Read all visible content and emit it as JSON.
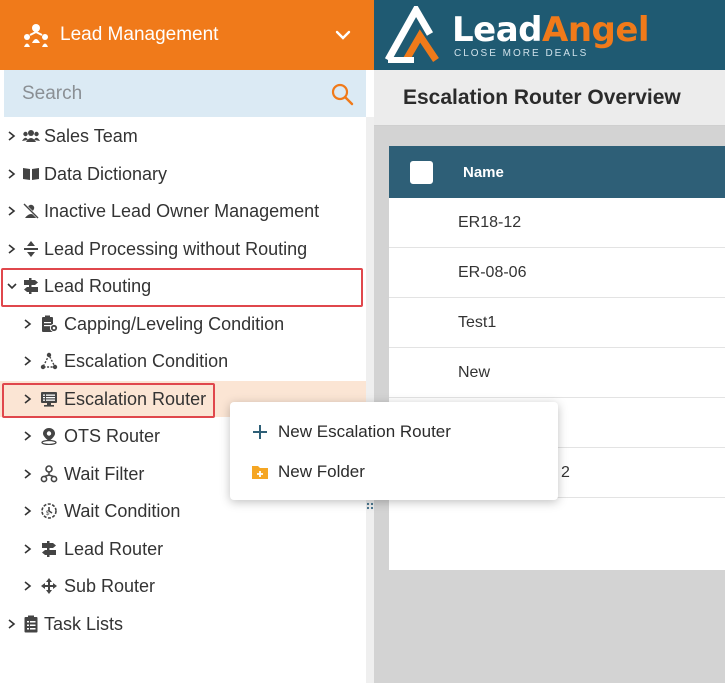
{
  "header": {
    "app_title": "Lead Management",
    "brand_first": "Lead",
    "brand_second": "Angel",
    "tagline": "CLOSE MORE DEALS"
  },
  "search": {
    "placeholder": "Search"
  },
  "sidebar": {
    "items": [
      {
        "label": "Sales Team",
        "icon": "users-icon"
      },
      {
        "label": "Data Dictionary",
        "icon": "book-icon"
      },
      {
        "label": "Inactive Lead Owner Management",
        "icon": "user-slash-icon"
      },
      {
        "label": "Lead Processing without Routing",
        "icon": "arrows-vertical-icon"
      },
      {
        "label": "Lead Routing",
        "icon": "signpost-icon",
        "expanded": true
      },
      {
        "label": "Capping/Leveling Condition",
        "icon": "clipboard-gear-icon"
      },
      {
        "label": "Escalation Condition",
        "icon": "triangle-nodes-icon"
      },
      {
        "label": "Escalation Router",
        "icon": "monitor-list-icon",
        "selected": true
      },
      {
        "label": "OTS Router",
        "icon": "location-pin-icon"
      },
      {
        "label": "Wait Filter",
        "icon": "hourglass-icon"
      },
      {
        "label": "Wait Condition",
        "icon": "stopwatch-icon"
      },
      {
        "label": "Lead Router",
        "icon": "signpost-icon"
      },
      {
        "label": "Sub Router",
        "icon": "arrows-cross-icon"
      },
      {
        "label": "Task Lists",
        "icon": "clipboard-list-icon"
      }
    ]
  },
  "content": {
    "title": "Escalation Router Overview",
    "table": {
      "columns": [
        "Name"
      ],
      "rows": [
        "ER18-12",
        "ER-08-06",
        "Test1",
        "New",
        "",
        "2"
      ]
    }
  },
  "context_menu": {
    "items": [
      {
        "label": "New Escalation Router",
        "icon": "plus-icon"
      },
      {
        "label": "New Folder",
        "icon": "folder-plus-icon"
      }
    ]
  },
  "colors": {
    "orange": "#f07a1a",
    "navy": "#1f5a72",
    "table_header": "#2e5f77",
    "highlight_border": "#e0474c",
    "selected_bg": "#fbe5d4",
    "search_bg": "#dbeaf4"
  }
}
